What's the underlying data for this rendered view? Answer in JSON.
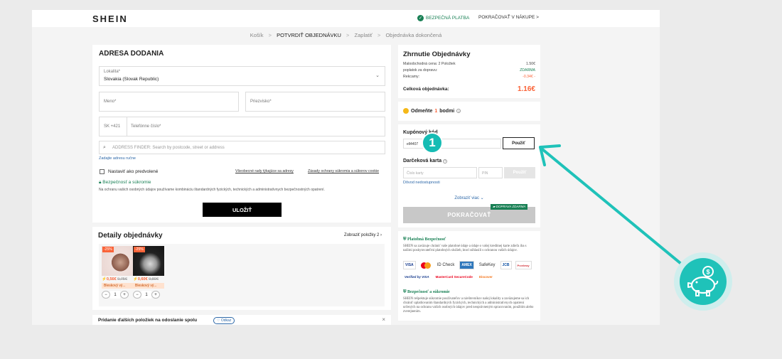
{
  "header": {
    "logo": "SHEIN",
    "secure_payment": "BEZPEČNÁ PLATBA",
    "continue_shopping": "POKRAČOVAŤ V NÁKUPE",
    "continue_chevron": ">"
  },
  "breadcrumb": {
    "items": [
      "Košík",
      "POTVRDIŤ OBJEDNÁVKU",
      "Zaplatiť",
      "Objednávka dokončená"
    ],
    "separator": ">"
  },
  "address": {
    "title": "ADRESA DODANIA",
    "country_label": "Lokalita*",
    "country_value": "Slovakia (Slovak Republic)",
    "first_name_placeholder": "Meno*",
    "last_name_placeholder": "Priezvisko*",
    "phone_prefix": "SK +421",
    "phone_placeholder": "Telefónne číslo*",
    "finder_placeholder": "ADDRESS FINDER: Search by postcode, street or address",
    "manual_link": "Zadajte adresu ručne",
    "default_label": "Nastaviť ako predvolené",
    "terms_link": "Všeobecné rady týkajúce sa adresy",
    "privacy_link": "Zásady ochrany súkromia a súborov cookie",
    "privacy_title": "Bezpečnosť a súkromie",
    "privacy_text": "Na ochranu vašich osobných údajov používame kombináciu štandardných fyzických, technických a administratívnych bezpečnostných opatrení.",
    "save_button": "ULOŽIŤ"
  },
  "order_details": {
    "title": "Detaily objednávky",
    "view_all": "Zobraziť položky 2",
    "items": [
      {
        "discount": "-25%",
        "price": "0,56€",
        "old_price": "0,75€",
        "tag": "Bleskový vý...",
        "qty": "1"
      },
      {
        "discount": "-25%",
        "price": "0,60€",
        "old_price": "0,80€",
        "tag": "Bleskový vý...",
        "qty": "1"
      }
    ],
    "minus": "−",
    "plus": "+"
  },
  "add_more": {
    "text": "Pridanie ďalších položiek na odoslanie spolu",
    "badge": "Odkaz",
    "close": "×"
  },
  "summary": {
    "title": "Zhrnutie Objednávky",
    "rows": [
      {
        "label": "Maloobchodná cena: 2 Položiek",
        "value": "1.50€"
      },
      {
        "label": "poplatok za dopravu:",
        "value": "ZDARMA"
      },
      {
        "label": "Rekcamy:",
        "value": "-0.34€ -"
      }
    ],
    "total_label": "Celková objednávka:",
    "total_value": "1.16€"
  },
  "points": {
    "text_before": "Odmeňte",
    "number": "1",
    "text_after": "bodmi"
  },
  "coupon": {
    "title": "Kupónový kód",
    "code_value": "ell4407",
    "apply": "Použiť",
    "gift_title": "Darčeková karta",
    "card_placeholder": "Číslo karty",
    "pin_placeholder": "PIN",
    "gift_apply": "Použiť",
    "unavailable": "Dôvod nedostupnosti",
    "show_more": "Zobraziť viac",
    "free_ship": "DOPRAVA ZDARMA",
    "continue": "POKRAČOVAŤ"
  },
  "security": {
    "pay_title": "Platobná Bezpečnosť",
    "pay_text": "SHEIN sa zaväzuje chrániť vaše platobné údaje a údaje o vašej kreditnej karte zdieľa iba s našimi poskytovateľmi platobných služieb, ktorí súhlasili s ochranou vašich údajov.",
    "logos": [
      "VISA",
      "ID Check",
      "AMEX",
      "SafeKey",
      "JCB",
      "Przelewy",
      "Verified by VISA",
      "MasterCard SecureCode",
      "Discover"
    ],
    "privacy_title": "Bezpečnosť a súkromie",
    "privacy_text": "SHEIN rešpektuje súkromie používateľov a návštevníkov našej lokality a zaväzujeme sa ich chrániť uplatňovaním štandardných fyzických, technických a administratívnych opatrení určených na ochranu vašich osobných údajov pred neoprávneným spracovaním, použitím alebo zverejnením."
  },
  "overlay": {
    "step_number": "1",
    "accent": "#1fc2b9"
  }
}
